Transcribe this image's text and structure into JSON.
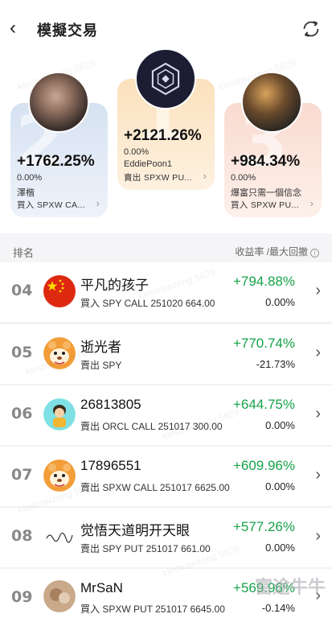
{
  "header": {
    "title": "模擬交易",
    "back_icon": "chevron-left-icon",
    "refresh_icon": "refresh-icon"
  },
  "podium": [
    {
      "rank": "2",
      "return": "+1762.25%",
      "drawdown": "0.00%",
      "name": "澤楷",
      "trade": "買入 SPXW CA...",
      "bg": "#dbe5f3"
    },
    {
      "rank": "1",
      "return": "+2121.26%",
      "drawdown": "0.00%",
      "name": "EddiePoon1",
      "trade": "賣出 SPXW PU...",
      "bg": "#fce7c8"
    },
    {
      "rank": "3",
      "return": "+984.34%",
      "drawdown": "0.00%",
      "name": "爆富只需一個信念",
      "trade": "買入 SPXW PU...",
      "bg": "#fbe2d9"
    }
  ],
  "list_header": {
    "rank_label": "排名",
    "yield_label": "收益率 /最大回撤"
  },
  "rows": [
    {
      "rank": "04",
      "name": "平凡的孩子",
      "trade": "買入 SPY CALL 251020 664.00",
      "return": "+794.88%",
      "drawdown": "0.00%"
    },
    {
      "rank": "05",
      "name": "逝光者",
      "trade": "賣出 SPY",
      "return": "+770.74%",
      "drawdown": "-21.73%"
    },
    {
      "rank": "06",
      "name": "26813805",
      "trade": "賣出 ORCL CALL 251017 300.00",
      "return": "+644.75%",
      "drawdown": "0.00%"
    },
    {
      "rank": "07",
      "name": "17896551",
      "trade": "賣出 SPXW CALL 251017 6625.00",
      "return": "+609.96%",
      "drawdown": "0.00%"
    },
    {
      "rank": "08",
      "name": "觉悟天道明开天眼",
      "trade": "賣出 SPY PUT 251017 661.00",
      "return": "+577.26%",
      "drawdown": "0.00%"
    },
    {
      "rank": "09",
      "name": "MrSaN",
      "trade": "買入 SPXW PUT 251017 6645.00",
      "return": "+569.96%",
      "drawdown": "-0.14%"
    }
  ],
  "watermark_text": "kinstrawzeng 5829",
  "brand_watermark": "富途牛牛",
  "colors": {
    "positive": "#16a34a",
    "rank_gray": "#888888"
  }
}
